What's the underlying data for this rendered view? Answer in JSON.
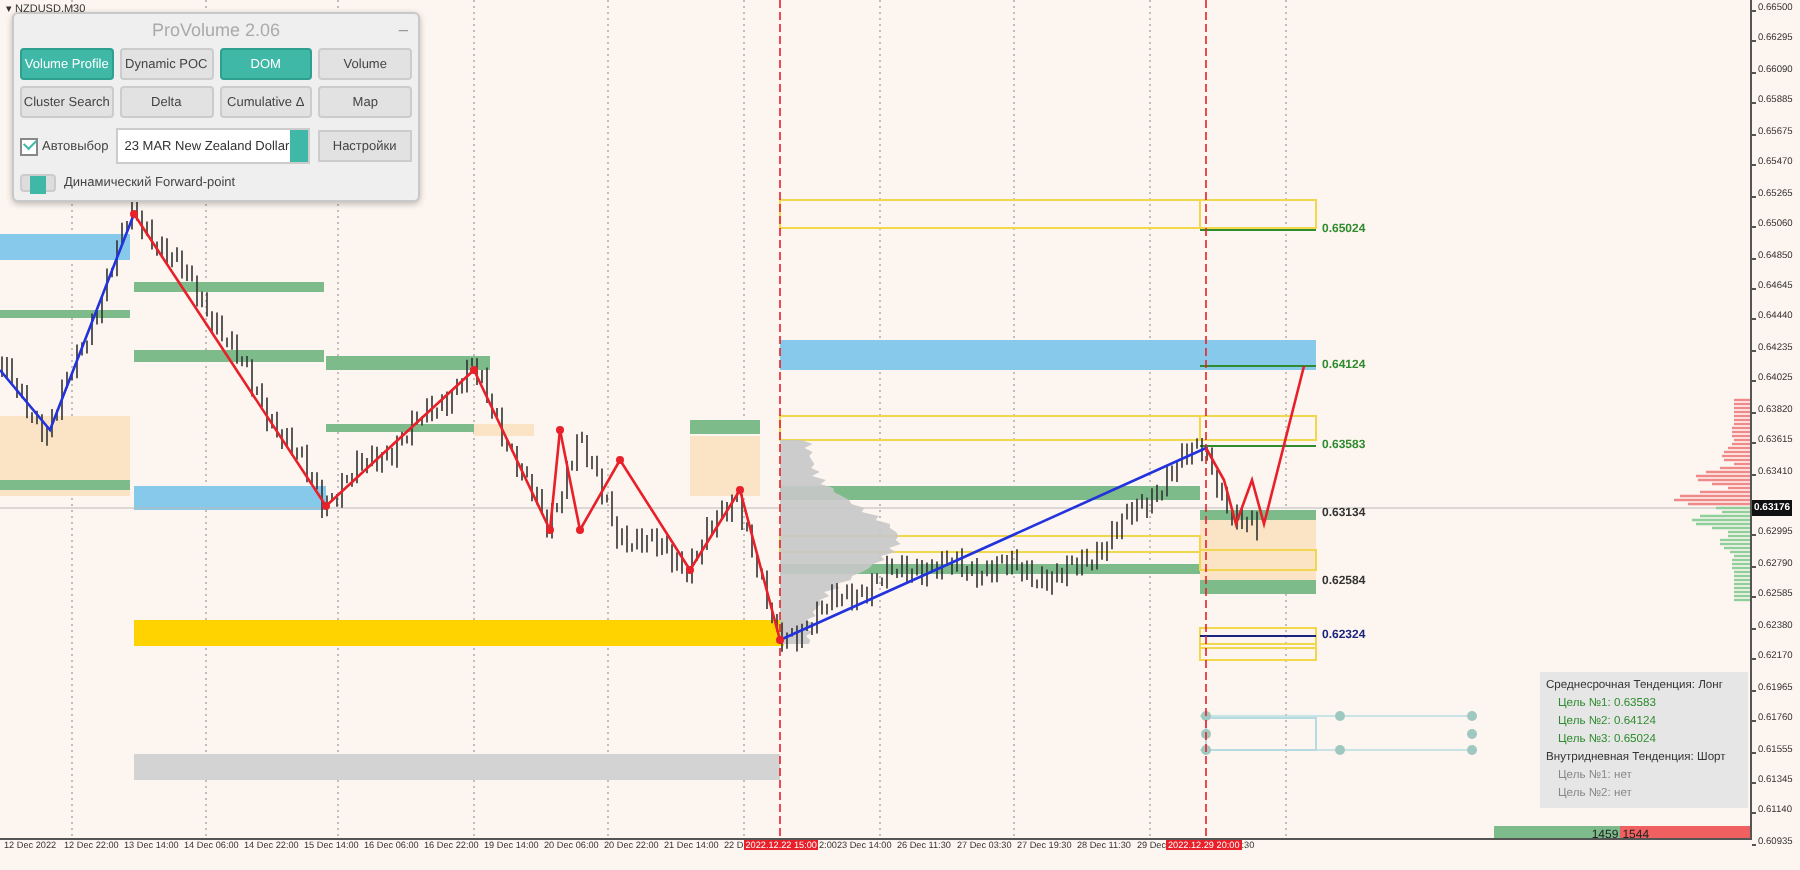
{
  "symbol": "▾ NZDUSD,M30",
  "panel": {
    "title": "ProVolume 2.06",
    "minimize": "_",
    "buttons": [
      {
        "label": "Volume Profile",
        "selected": true
      },
      {
        "label": "Dynamic POC",
        "selected": false
      },
      {
        "label": "DOM",
        "selected": true
      },
      {
        "label": "Volume",
        "selected": false
      },
      {
        "label": "Cluster Search",
        "selected": false
      },
      {
        "label": "Delta",
        "selected": false
      },
      {
        "label": "Cumulative Δ",
        "selected": false
      },
      {
        "label": "Map",
        "selected": false
      }
    ],
    "auto_select": {
      "label": "Автовыбор",
      "checked": true
    },
    "instrument": "23 MAR New Zealand Dollar",
    "settings_button": "Настройки",
    "forward_point": {
      "label": "Динамический Forward-point",
      "on": true
    }
  },
  "level_labels": [
    {
      "text": "0.65024",
      "color": "#2e8b2e"
    },
    {
      "text": "0.64124",
      "color": "#2e8b2e"
    },
    {
      "text": "0.63583",
      "color": "#2e8b2e"
    },
    {
      "text": "0.63134",
      "color": "#333333"
    },
    {
      "text": "0.62584",
      "color": "#333333"
    },
    {
      "text": "0.62324",
      "color": "#1a237e"
    }
  ],
  "price_axis": {
    "ticks": [
      "0.66500",
      "0.66295",
      "0.66090",
      "0.65885",
      "0.65675",
      "0.65470",
      "0.65265",
      "0.65060",
      "0.64850",
      "0.64645",
      "0.64440",
      "0.64235",
      "0.64025",
      "0.63820",
      "0.63615",
      "0.63410",
      "0.62995",
      "0.62790",
      "0.62585",
      "0.62380",
      "0.62170",
      "0.61965",
      "0.61760",
      "0.61555",
      "0.61345",
      "0.61140",
      "0.60935"
    ],
    "current": "0.63176"
  },
  "time_axis": [
    {
      "text": "12 Dec 2022",
      "kind": "normal"
    },
    {
      "text": "12 Dec 22:00",
      "kind": "normal"
    },
    {
      "text": "13 Dec 14:00",
      "kind": "normal"
    },
    {
      "text": "14 Dec 06:00",
      "kind": "normal"
    },
    {
      "text": "14 Dec 22:00",
      "kind": "normal"
    },
    {
      "text": "15 Dec 14:00",
      "kind": "normal"
    },
    {
      "text": "16 Dec 06:00",
      "kind": "normal"
    },
    {
      "text": "16 Dec 22:00",
      "kind": "normal"
    },
    {
      "text": "19 Dec 14:00",
      "kind": "normal"
    },
    {
      "text": "20 Dec 06:00",
      "kind": "normal"
    },
    {
      "text": "20 Dec 22:00",
      "kind": "normal"
    },
    {
      "text": "21 Dec 14:00",
      "kind": "normal"
    },
    {
      "text": "22 D",
      "kind": "partial"
    },
    {
      "text": "2022.12.22 15:00",
      "kind": "highlight"
    },
    {
      "text": "2:00",
      "kind": "partial"
    },
    {
      "text": "23 Dec 14:00",
      "kind": "normal"
    },
    {
      "text": "26 Dec 11:30",
      "kind": "normal"
    },
    {
      "text": "27 Dec 03:30",
      "kind": "normal"
    },
    {
      "text": "27 Dec 19:30",
      "kind": "normal"
    },
    {
      "text": "28 Dec 11:30",
      "kind": "normal"
    },
    {
      "text": "29 Dec",
      "kind": "partial"
    },
    {
      "text": "2022.12.29 20:00",
      "kind": "highlight"
    },
    {
      "text": ":30",
      "kind": "partial"
    }
  ],
  "trend_info": {
    "medium_trend": "Среднесрочная Тенденция: Лонг",
    "medium_targets": [
      "Цель №1: 0.63583",
      "Цель №2: 0.64124",
      "Цель №3: 0.65024"
    ],
    "intraday_trend": "Внутридневная Тенденция: Шорт",
    "intraday_targets": [
      "Цель №1: нет",
      "Цель №2: нет"
    ]
  },
  "balance": {
    "buy": "1459",
    "sell": "1544",
    "level": 0.49
  }
}
